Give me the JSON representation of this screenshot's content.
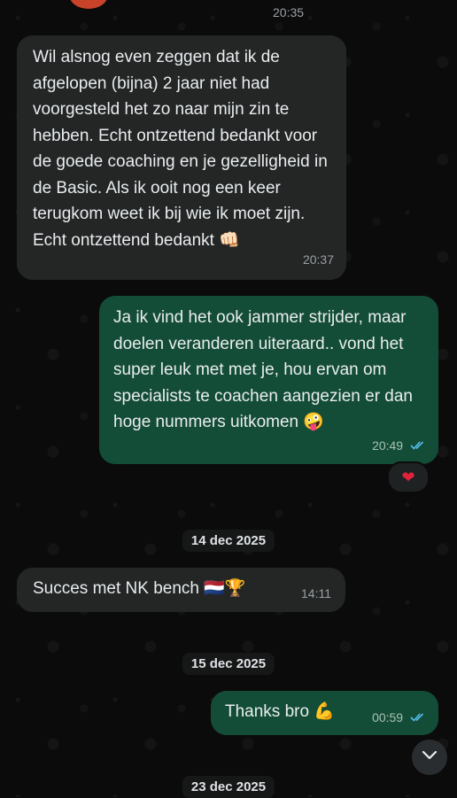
{
  "top": {
    "partial_time": "20:35"
  },
  "messages": [
    {
      "direction": "incoming",
      "text": "Wil alsnog even zeggen dat ik de afgelopen (bijna) 2 jaar niet had voorgesteld het zo naar mijn zin te hebben. Echt ontzettend bedankt voor de goede coaching en je gezelligheid in de Basic. Als ik ooit nog een keer terugkom weet ik bij wie ik moet zijn. Echt ontzettend bedankt",
      "emoji": "👊🏻",
      "time": "20:37"
    },
    {
      "direction": "outgoing",
      "text": "Ja ik vind het ook jammer strijder, maar doelen veranderen uiteraard.. vond het super leuk met met je, hou ervan om specialists te coachen aangezien er dan hoge nummers uitkomen",
      "emoji": "🤪",
      "time": "20:49",
      "reaction": "❤"
    },
    {
      "direction": "date",
      "label": "14 dec 2025"
    },
    {
      "direction": "incoming",
      "text": "Succes met NK bench",
      "emoji": "🇳🇱🏆",
      "time": "14:11"
    },
    {
      "direction": "date",
      "label": "15 dec 2025"
    },
    {
      "direction": "outgoing",
      "text": "Thanks bro",
      "emoji": "💪",
      "time": "00:59"
    },
    {
      "direction": "date",
      "label": "23 dec 2025"
    }
  ],
  "icons": {
    "read_receipt": "double-check-icon",
    "scroll_down": "chevron-down-icon",
    "reaction": "heart-icon"
  },
  "colors": {
    "incoming_bubble": "#242626",
    "outgoing_bubble": "#144d37",
    "read_tick": "#53bdeb",
    "heart": "#e0223a"
  }
}
